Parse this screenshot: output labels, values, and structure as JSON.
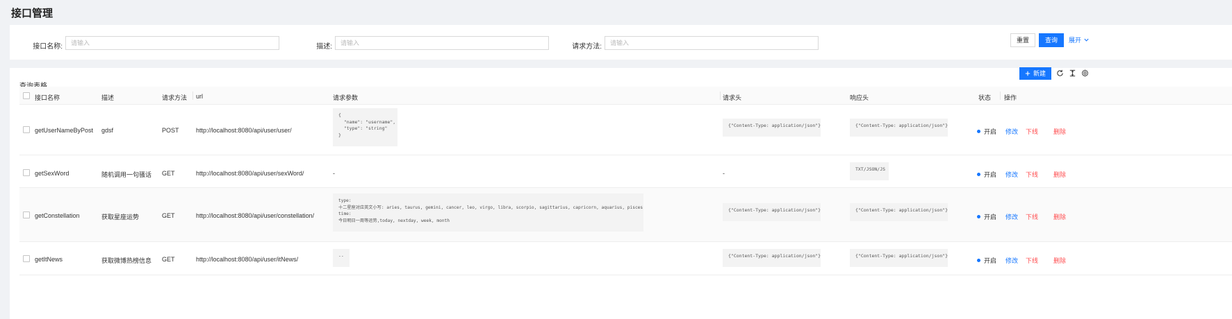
{
  "page": {
    "title": "接口管理"
  },
  "search": {
    "fields": [
      {
        "label": "接口名称:",
        "placeholder": "请输入"
      },
      {
        "label": "描述:",
        "placeholder": "请输入"
      },
      {
        "label": "请求方法:",
        "placeholder": "请输入"
      }
    ],
    "reset_label": "重置",
    "query_label": "查询",
    "expand_label": "展开"
  },
  "table": {
    "title": "查询表格",
    "new_label": "新建",
    "columns": {
      "name": "接口名称",
      "description": "描述",
      "method": "请求方法",
      "url": "url",
      "params": "请求参数",
      "req_header": "请求头",
      "resp_header": "响应头",
      "status": "状态",
      "actions": "操作"
    },
    "rows": [
      {
        "name": "getUserNameByPost",
        "description": "gdsf",
        "method": "POST",
        "url": "http://localhost:8080/api/user/user/",
        "params": "{\n  \"name\": \"username\",\n  \"type\": \"string\"\n}",
        "req_header": "{\"Content-Type: application/json\"}",
        "resp_header": "{\"Content-Type: application/json\"}",
        "status": "开启"
      },
      {
        "name": "getSexWord",
        "description": "随机调用一句骚话",
        "method": "GET",
        "url": "http://localhost:8080/api/user/sexWord/",
        "params": "-",
        "req_header": "-",
        "resp_header": "TXT/JSON/JS",
        "status": "开启"
      },
      {
        "name": "getConstellation",
        "description": "获取星座运势",
        "method": "GET",
        "url": "http://localhost:8080/api/user/constellation/",
        "params": "type:\n十二星座对应英文小写: aries, taurus, gemini, cancer, leo, virgo, libra, scorpio, sagittarius, capricorn, aquarius, pisces\ntime:\n今日明日一周等运势,today, nextday, week, month",
        "req_header": "{\"Content-Type: application/json\"}",
        "resp_header": "{\"Content-Type: application/json\"}",
        "status": "开启"
      },
      {
        "name": "getItNews",
        "description": "获取微博热榜信息",
        "method": "GET",
        "url": "http://localhost:8080/api/user/itNews/",
        "params": "--",
        "req_header": "{\"Content-Type: application/json\"}",
        "resp_header": "{\"Content-Type: application/json\"}",
        "status": "开启"
      }
    ],
    "actions": {
      "edit": "修改",
      "offline": "下线",
      "delete": "删除"
    }
  },
  "colors": {
    "primary": "#1677ff",
    "danger": "#ff4d4f",
    "status_on": "#1677ff"
  },
  "icons": [
    "plus-icon",
    "reload-icon",
    "column-height-icon",
    "setting-icon",
    "chevron-down-icon"
  ]
}
